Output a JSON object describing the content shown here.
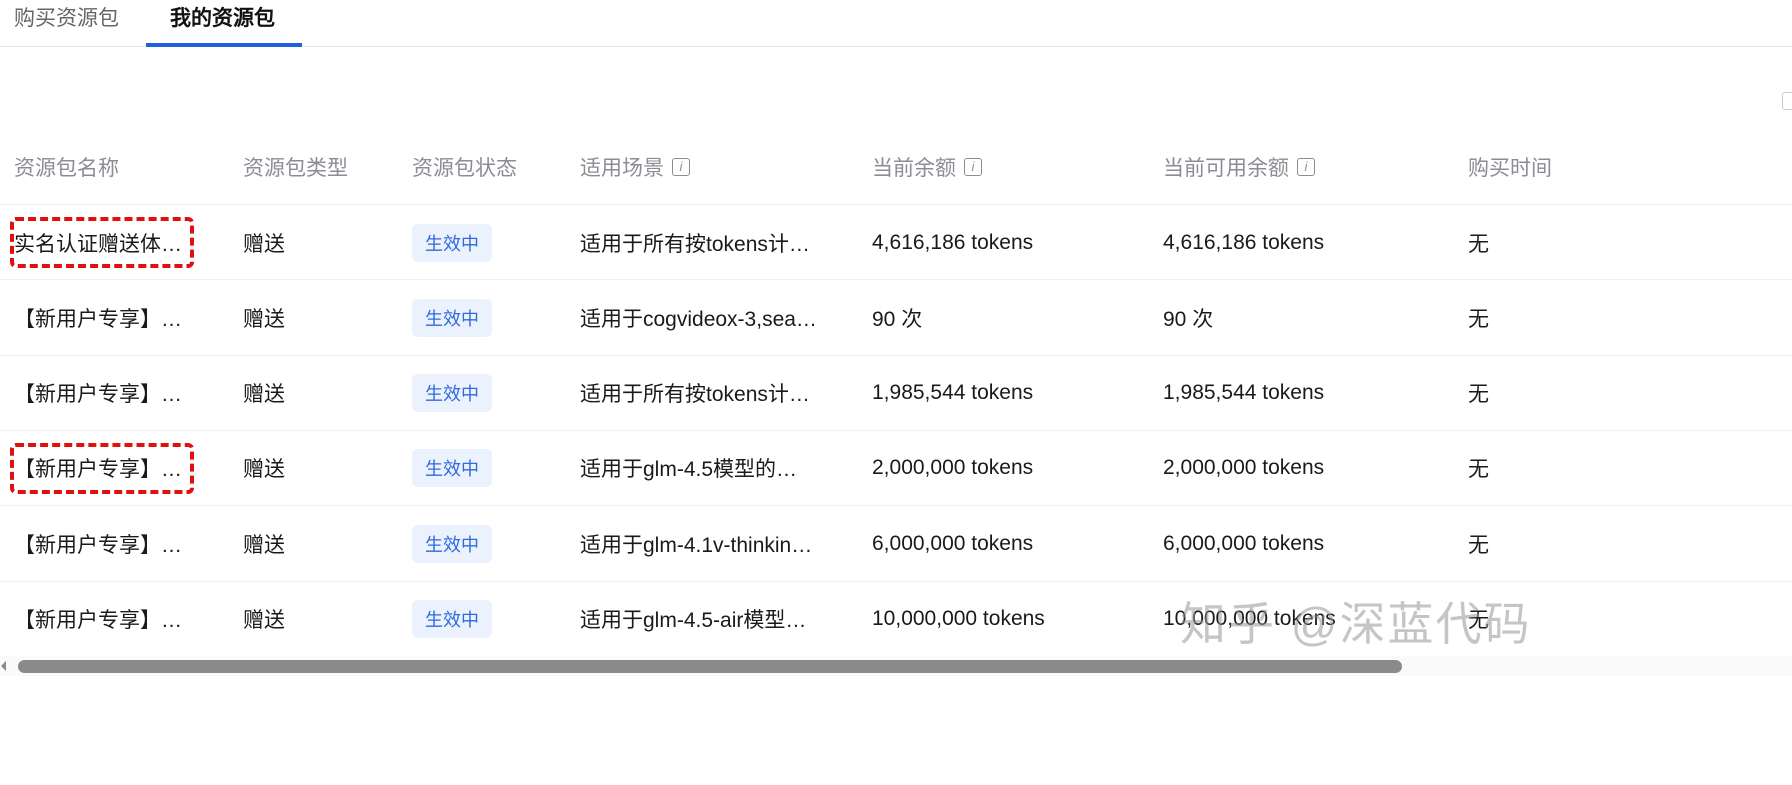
{
  "tabs": [
    {
      "label": "购买资源包"
    },
    {
      "label": "我的资源包"
    }
  ],
  "columns": [
    "资源包名称",
    "资源包类型",
    "资源包状态",
    "适用场景",
    "当前余额",
    "当前可用余额",
    "购买时间"
  ],
  "rows": [
    {
      "name": "实名认证赠送体…",
      "type": "赠送",
      "status": "生效中",
      "scene": "适用于所有按tokens计…",
      "balance": "4,616,186 tokens",
      "available": "4,616,186 tokens",
      "time": "无",
      "highlighted": true
    },
    {
      "name": "【新用户专享】…",
      "type": "赠送",
      "status": "生效中",
      "scene": "适用于cogvideox-3,sea…",
      "balance": "90 次",
      "available": "90 次",
      "time": "无",
      "highlighted": false
    },
    {
      "name": "【新用户专享】…",
      "type": "赠送",
      "status": "生效中",
      "scene": "适用于所有按tokens计…",
      "balance": "1,985,544 tokens",
      "available": "1,985,544 tokens",
      "time": "无",
      "highlighted": false
    },
    {
      "name": "【新用户专享】…",
      "type": "赠送",
      "status": "生效中",
      "scene": "适用于glm-4.5模型的…",
      "balance": "2,000,000 tokens",
      "available": "2,000,000 tokens",
      "time": "无",
      "highlighted": true
    },
    {
      "name": "【新用户专享】…",
      "type": "赠送",
      "status": "生效中",
      "scene": "适用于glm-4.1v-thinkin…",
      "balance": "6,000,000 tokens",
      "available": "6,000,000 tokens",
      "time": "无",
      "highlighted": false
    },
    {
      "name": "【新用户专享】…",
      "type": "赠送",
      "status": "生效中",
      "scene": "适用于glm-4.5-air模型…",
      "balance": "10,000,000 tokens",
      "available": "10,000,000 tokens",
      "time": "无",
      "highlighted": false
    }
  ],
  "watermark": "知乎 @深蓝代码",
  "colors": {
    "accent": "#1f5fe0",
    "badge_bg": "#ebf1fd",
    "badge_text": "#2f6bdc",
    "highlight": "#e01010"
  }
}
